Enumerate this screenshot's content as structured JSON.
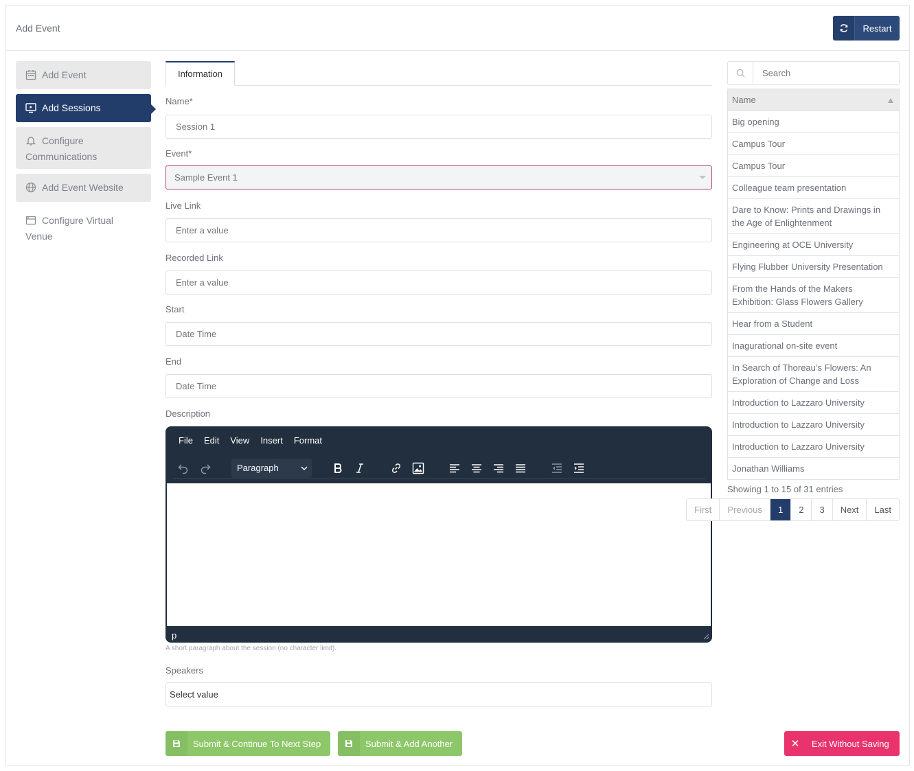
{
  "header": {
    "title": "Add Event",
    "restart_label": "Restart"
  },
  "sidebar": {
    "items": [
      {
        "label": "Add Event",
        "icon": "calendar-icon"
      },
      {
        "label": "Add Sessions",
        "icon": "monitor-icon"
      },
      {
        "label": "Configure Communications",
        "icon": "bell-icon"
      },
      {
        "label": "Add Event Website",
        "icon": "globe-icon"
      },
      {
        "label": "Configure Virtual Venue",
        "icon": "browser-window-icon"
      }
    ]
  },
  "tabs": {
    "information": "Information"
  },
  "form": {
    "name": {
      "label": "Name*",
      "value": "Session 1"
    },
    "event": {
      "label": "Event*",
      "value": "Sample Event 1"
    },
    "live_link": {
      "label": "Live Link",
      "placeholder": "Enter a value"
    },
    "recorded_link": {
      "label": "Recorded Link",
      "placeholder": "Enter a value"
    },
    "start": {
      "label": "Start",
      "placeholder": "Date Time"
    },
    "end": {
      "label": "End",
      "placeholder": "Date Time"
    },
    "description": {
      "label": "Description",
      "menu": [
        "File",
        "Edit",
        "View",
        "Insert",
        "Format"
      ],
      "block_format": "Paragraph",
      "status_path": "p",
      "help": "A short paragraph about the session (no character limit)."
    },
    "speakers": {
      "label": "Speakers",
      "placeholder": "Select value"
    }
  },
  "actions": {
    "submit_continue": "Submit & Continue To Next Step",
    "submit_add": "Submit & Add Another",
    "exit": "Exit Without Saving"
  },
  "sessions_panel": {
    "search_placeholder": "Search",
    "column": "Name",
    "rows": [
      "Big opening",
      "Campus Tour",
      "Campus Tour",
      "Colleague team presentation",
      "Dare to Know: Prints and Drawings in the Age of Enlightenment",
      "Engineering at OCE University",
      "Flying Flubber University Presentation",
      "From the Hands of the Makers Exhibition: Glass Flowers Gallery",
      "Hear from a Student",
      "Inagurational on-site event",
      "In Search of Thoreau’s Flowers: An Exploration of Change and Loss",
      "Introduction to Lazzaro University",
      "Introduction to Lazzaro University",
      "Introduction to Lazzaro University",
      "Jonathan Williams"
    ],
    "showing": "Showing 1 to 15 of 31 entries",
    "pager": {
      "first": "First",
      "previous": "Previous",
      "pages": [
        "1",
        "2",
        "3"
      ],
      "current": "1",
      "next": "Next",
      "last": "Last"
    }
  },
  "colors": {
    "primary": "#233d6b",
    "success": "#8dc76a",
    "danger": "#e8336d"
  }
}
